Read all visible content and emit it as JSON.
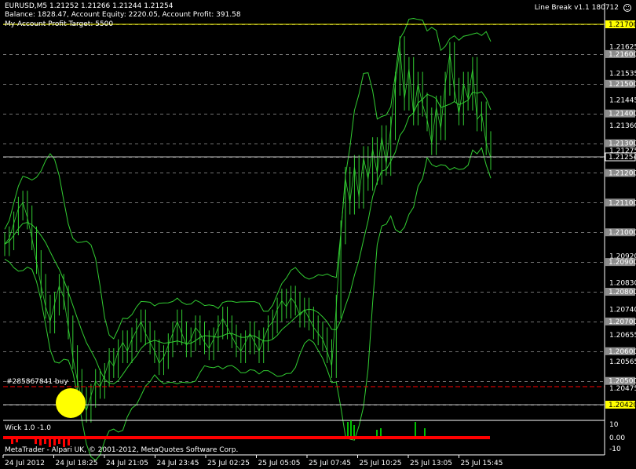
{
  "header": {
    "symbol_line": "EURUSD,M5  1.21252 1.21266 1.21244 1.21254",
    "account_line": "Balance: 1828.47, Account Equity: 2220.05, Account Profit: 391.58",
    "target_line": "My Account Profit Target: 5500"
  },
  "expert": {
    "name": "Line Break  v1.1 180712",
    "icon": "smiley-icon"
  },
  "order": {
    "label": "#285867841 buy",
    "price": 1.20483
  },
  "copyright": "MetaTrader - Alpari UK, © 2001-2012, MetaQuotes Software Corp.",
  "indicator": {
    "name": "Wick 1.0 -1.0",
    "scale": [
      "10",
      "0.00",
      "-10"
    ]
  },
  "price_scale": [
    "1.21625",
    "1.21535",
    "1.21445",
    "1.21360",
    "1.21275",
    "1.20920",
    "1.20830",
    "1.20740",
    "1.20655",
    "1.20565",
    "1.20475"
  ],
  "level_labels": [
    "1.21700",
    "1.21600",
    "1.21500",
    "1.21400",
    "1.21300",
    "1.21254",
    "1.21200",
    "1.21100",
    "1.21000",
    "1.20900",
    "1.20800",
    "1.20700",
    "1.20600",
    "1.20500",
    "1.20420"
  ],
  "time_labels": [
    "24 Jul 2012",
    "24 Jul 18:25",
    "24 Jul 21:05",
    "24 Jul 23:45",
    "25 Jul 02:25",
    "25 Jul 05:05",
    "25 Jul 07:45",
    "25 Jul 10:25",
    "25 Jul 13:05",
    "25 Jul 15:45"
  ],
  "colors": {
    "background": "#000000",
    "candles": "#32cd32",
    "bands": "#32cd32",
    "grid": "#c0c0c0",
    "target": "#ffff00",
    "order": "#ff0000",
    "highlight": "#ffff00",
    "indicator_bar": "#ff0000",
    "wick_up": "#00c000"
  },
  "chart_data": {
    "type": "line",
    "ylim": [
      1.2038,
      1.2175
    ],
    "series": [
      {
        "values": [
          1.2096,
          1.2098,
          1.2103,
          1.2108,
          1.211,
          1.2105,
          1.2098,
          1.209,
          1.2082,
          1.2075,
          1.207,
          1.2076,
          1.2082,
          1.2078,
          1.2068,
          1.2058,
          1.205,
          1.2044,
          1.204,
          1.2045,
          1.205,
          1.2048,
          1.2052,
          1.2057,
          1.2055,
          1.206,
          1.2063,
          1.206,
          1.2064,
          1.2067,
          1.207,
          1.2066,
          1.2063,
          1.206,
          1.2056,
          1.2058,
          1.2062,
          1.2066,
          1.207,
          1.2066,
          1.2062,
          1.2064,
          1.2068,
          1.2066,
          1.2063,
          1.2061,
          1.2064,
          1.2068,
          1.2071,
          1.2068,
          1.2065,
          1.2062,
          1.206,
          1.2063,
          1.2066,
          1.2063,
          1.206,
          1.2064,
          1.2068,
          1.207,
          1.2074,
          1.2077,
          1.2075,
          1.2078,
          1.2076,
          1.2072,
          1.2074,
          1.2071,
          1.2068,
          1.2066,
          1.2064,
          1.206,
          1.2055,
          1.2075,
          1.21,
          1.2118,
          1.211,
          1.2122,
          1.2112,
          1.2125,
          1.2118,
          1.2128,
          1.212,
          1.2132,
          1.2123,
          1.2135,
          1.215,
          1.2162,
          1.2145,
          1.2155,
          1.214,
          1.215,
          1.2143,
          1.2138,
          1.213,
          1.2142,
          1.2135,
          1.215,
          1.216,
          1.2148,
          1.214,
          1.215,
          1.2145,
          1.2155,
          1.2138,
          1.214,
          1.213,
          1.2125
        ]
      }
    ]
  }
}
